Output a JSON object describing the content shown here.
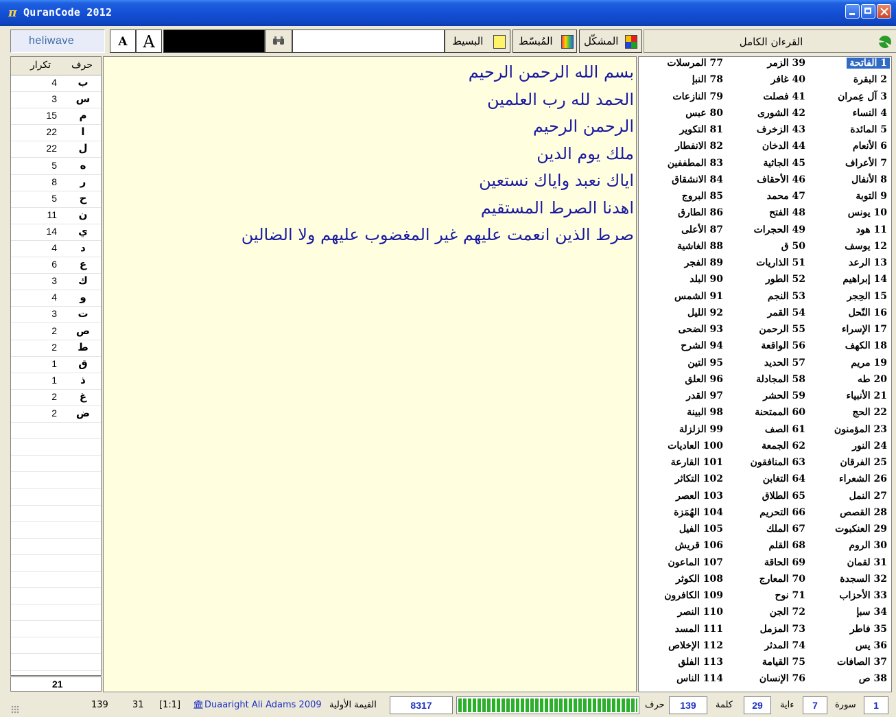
{
  "window": {
    "icon": "π",
    "title": "QuranCode 2012"
  },
  "toolbar": {
    "brand": "heliwave",
    "font_small_label": "A",
    "font_large_label": "A",
    "search_placeholder": "",
    "mode_basit": "البسيط",
    "mode_mubassat": "المُبسّط",
    "mode_mushakkal": "المشكّل",
    "quran_title": "القرءان الكامل"
  },
  "letters": {
    "header_count": "تكرار",
    "header_letter": "حرف",
    "rows": [
      {
        "letter": "ب",
        "count": "4"
      },
      {
        "letter": "س",
        "count": "3"
      },
      {
        "letter": "م",
        "count": "15"
      },
      {
        "letter": "ا",
        "count": "22"
      },
      {
        "letter": "ل",
        "count": "22"
      },
      {
        "letter": "ه",
        "count": "5"
      },
      {
        "letter": "ر",
        "count": "8"
      },
      {
        "letter": "ح",
        "count": "5"
      },
      {
        "letter": "ن",
        "count": "11"
      },
      {
        "letter": "ي",
        "count": "14"
      },
      {
        "letter": "د",
        "count": "4"
      },
      {
        "letter": "ع",
        "count": "6"
      },
      {
        "letter": "ك",
        "count": "3"
      },
      {
        "letter": "و",
        "count": "4"
      },
      {
        "letter": "ت",
        "count": "3"
      },
      {
        "letter": "ص",
        "count": "2"
      },
      {
        "letter": "ط",
        "count": "2"
      },
      {
        "letter": "ق",
        "count": "1"
      },
      {
        "letter": "ذ",
        "count": "1"
      },
      {
        "letter": "غ",
        "count": "2"
      },
      {
        "letter": "ض",
        "count": "2"
      }
    ],
    "total": "21"
  },
  "verses": [
    "بسم الله الرحمن الرحيم",
    "الحمد لله رب العلمين",
    "الرحمن الرحيم",
    "ملك يوم الدين",
    "اياك نعبد واياك نستعين",
    "اهدنا الصرط المستقيم",
    "صرط الذين انعمت عليهم غير المغضوب عليهم ولا الضالين"
  ],
  "surahs": [
    "1 الفاتحة",
    "2 البقرة",
    "3 آل عِمران",
    "4 النساء",
    "5 المائدة",
    "6 الأنعام",
    "7 الأعراف",
    "8 الأنفال",
    "9 التوبة",
    "10 يونس",
    "11 هود",
    "12 يوسف",
    "13 الرعد",
    "14 إبراهيم",
    "15 الحِجر",
    "16 النّحل",
    "17 الإسراء",
    "18 الكهف",
    "19 مريم",
    "20 طه",
    "21 الأنبياء",
    "22 الحج",
    "23 المؤمنون",
    "24 النور",
    "25 الفرقان",
    "26 الشعراء",
    "27 النمل",
    "28 القصص",
    "29 العنكبوت",
    "30 الروم",
    "31 لقمان",
    "32 السجدة",
    "33 الأحزاب",
    "34 سبإ",
    "35 فاطر",
    "36 يس",
    "37 الصافات",
    "38 ص",
    "39 الزمر",
    "40 غافر",
    "41 فصلت",
    "42 الشورى",
    "43 الزخرف",
    "44 الدخان",
    "45 الجاثية",
    "46 الأحقاف",
    "47 محمد",
    "48 الفتح",
    "49 الحجرات",
    "50 ق",
    "51 الذاريات",
    "52 الطور",
    "53 النجم",
    "54 القمر",
    "55 الرحمن",
    "56 الواقعة",
    "57 الحديد",
    "58 المجادلة",
    "59 الحشر",
    "60 الممتحنة",
    "61 الصف",
    "62 الجمعة",
    "63 المنافقون",
    "64 التغابن",
    "65 الطلاق",
    "66 التحريم",
    "67 الملك",
    "68 القلم",
    "69 الحاقة",
    "70 المعارج",
    "71 نوح",
    "72 الجن",
    "73 المزمل",
    "74 المدثر",
    "75 القيامة",
    "76 الإنسان",
    "77 المرسلات",
    "78 النبإ",
    "79 النازعات",
    "80 عبس",
    "81 التكوير",
    "82 الانفطار",
    "83 المطففين",
    "84 الانشقاق",
    "85 البروج",
    "86 الطارق",
    "87 الأعلى",
    "88 الغاشية",
    "89 الفجر",
    "90 البلد",
    "91 الشمس",
    "92 الليل",
    "93 الضحى",
    "94 الشرح",
    "95 التين",
    "96 العلق",
    "97 القدر",
    "98 البينة",
    "99 الزلزلة",
    "100 العاديات",
    "101 القارعة",
    "102 التكاثر",
    "103 العصر",
    "104 الهُمَزة",
    "105 الفيل",
    "106 قريش",
    "107 الماعون",
    "108 الكوثر",
    "109 الكافرون",
    "110 النصر",
    "111 المسد",
    "112 الإخلاص",
    "113 الفلق",
    "114 الناس"
  ],
  "selected_surah": "1 الفاتحة",
  "status": {
    "left_num1": "139",
    "left_num2": "31",
    "ref": "[1:1]",
    "credit_icon": "🏛",
    "credit": "Duaaright Ali Adams 2009",
    "value_label": "القيمة الأولية",
    "value": "8317",
    "progress_fraction": 1.0,
    "letters_label": "حرف",
    "letters_value": "139",
    "words_label": "كلمة",
    "words_value": "29",
    "verse_label": "ءاية",
    "verse_value": "7",
    "surah_label": "سورة",
    "surah_value": "1"
  }
}
